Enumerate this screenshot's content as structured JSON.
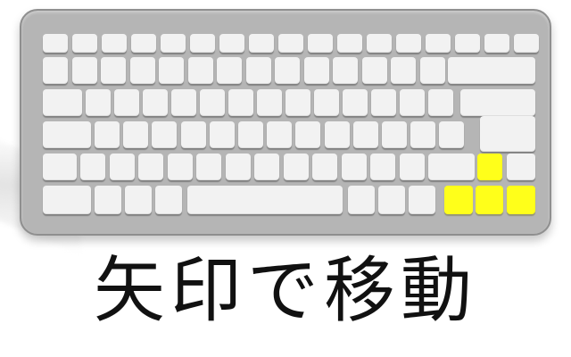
{
  "caption": "矢印で移動",
  "colors": {
    "keyboard_frame": "#b5b5b5",
    "key": "#f2f2f2",
    "arrow_key_highlight": "#ffff1a"
  },
  "highlighted_keys": [
    "up-arrow",
    "left-arrow",
    "down-arrow",
    "right-arrow"
  ]
}
